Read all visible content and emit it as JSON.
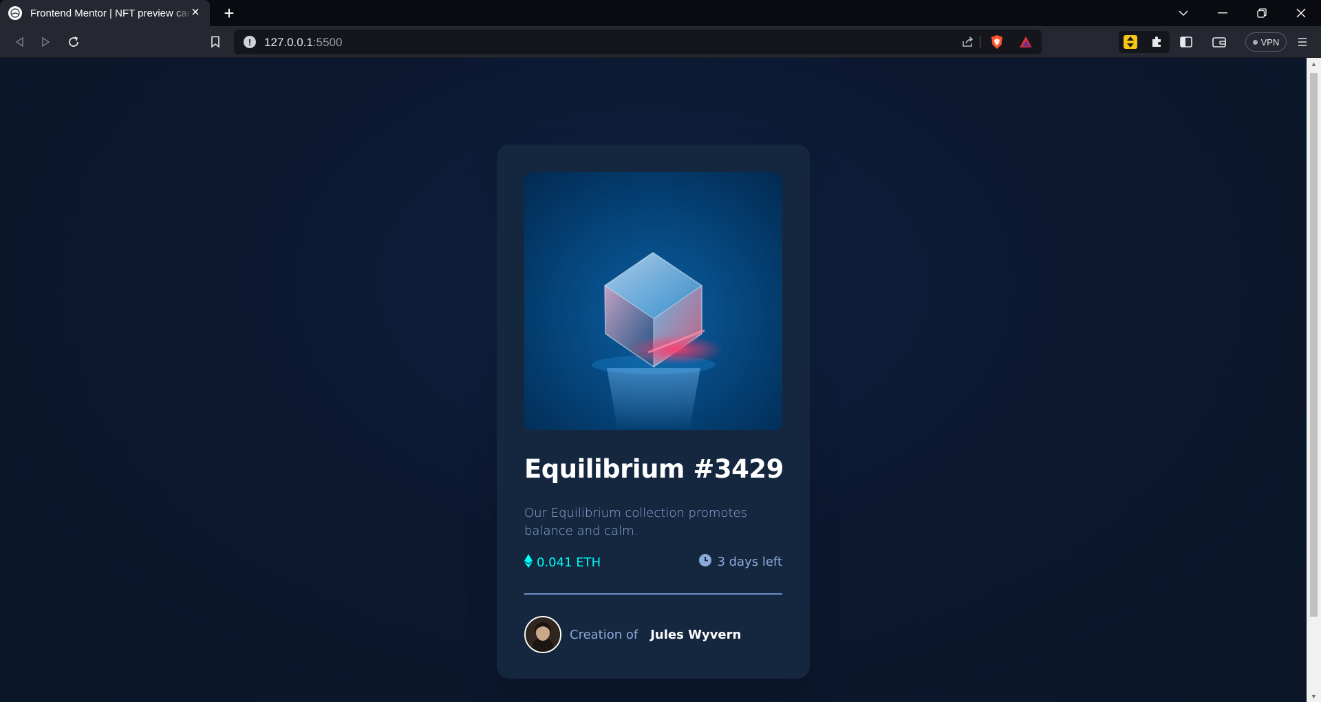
{
  "browser": {
    "tab": {
      "title": "Frontend Mentor | NFT preview card component"
    },
    "address": {
      "host": "127.0.0.1",
      "port": ":5500"
    },
    "vpn_label": "VPN"
  },
  "card": {
    "title": "Equilibrium #3429",
    "description": "Our Equilibrium collection promotes balance and calm.",
    "price": "0.041 ETH",
    "time_left": "3 days left",
    "creator_prefix": "Creation of",
    "creator_name": "Jules Wyvern"
  },
  "colors": {
    "page_bg": "#0d1a2e",
    "card_bg": "#15263f",
    "cyan": "#00fff8",
    "soft_blue": "#8bacd9",
    "white": "#ffffff"
  },
  "icons": [
    "globe-icon",
    "close-icon",
    "plus-icon",
    "chevron-down-icon",
    "minimize-icon",
    "restore-icon",
    "back-icon",
    "forward-icon",
    "reload-icon",
    "bookmark-icon",
    "info-icon",
    "share-icon",
    "brave-shield-icon",
    "brave-rewards-icon",
    "extension-icon",
    "puzzle-icon",
    "sidebar-icon",
    "wallet-icon",
    "menu-icon",
    "ethereum-icon",
    "clock-icon"
  ]
}
